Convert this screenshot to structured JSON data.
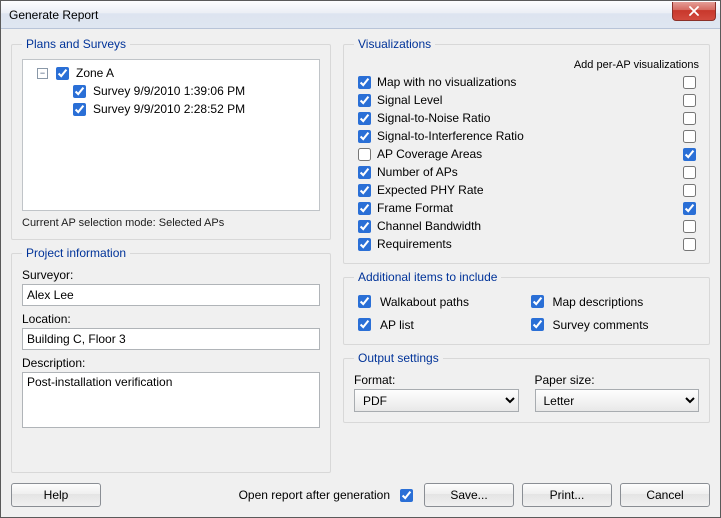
{
  "window": {
    "title": "Generate Report"
  },
  "plans": {
    "legend": "Plans and Surveys",
    "tree": {
      "root": {
        "label": "Zone A",
        "checked": true,
        "expanded": true
      },
      "children": [
        {
          "label": "Survey 9/9/2010 1:39:06 PM",
          "checked": true
        },
        {
          "label": "Survey 9/9/2010 2:28:52 PM",
          "checked": true
        }
      ]
    },
    "mode_note": "Current AP selection mode: Selected APs"
  },
  "project": {
    "legend": "Project information",
    "surveyor_label": "Surveyor:",
    "surveyor_value": "Alex Lee",
    "location_label": "Location:",
    "location_value": "Building C, Floor 3",
    "description_label": "Description:",
    "description_value": "Post-installation verification"
  },
  "vis": {
    "legend": "Visualizations",
    "per_ap_header": "Add per-AP visualizations",
    "items": [
      {
        "label": "Map with no visualizations",
        "c1": true,
        "c2": false
      },
      {
        "label": "Signal Level",
        "c1": true,
        "c2": false
      },
      {
        "label": "Signal-to-Noise Ratio",
        "c1": true,
        "c2": false
      },
      {
        "label": "Signal-to-Interference Ratio",
        "c1": true,
        "c2": false
      },
      {
        "label": "AP Coverage Areas",
        "c1": false,
        "c2": true
      },
      {
        "label": "Number of APs",
        "c1": true,
        "c2": false
      },
      {
        "label": "Expected PHY Rate",
        "c1": true,
        "c2": false
      },
      {
        "label": "Frame Format",
        "c1": true,
        "c2": true
      },
      {
        "label": "Channel Bandwidth",
        "c1": true,
        "c2": false
      },
      {
        "label": "Requirements",
        "c1": true,
        "c2": false
      }
    ]
  },
  "addl": {
    "legend": "Additional items to include",
    "items": [
      {
        "label": "Walkabout paths",
        "checked": true
      },
      {
        "label": "Map descriptions",
        "checked": true
      },
      {
        "label": "AP list",
        "checked": true
      },
      {
        "label": "Survey comments",
        "checked": true
      }
    ]
  },
  "output": {
    "legend": "Output settings",
    "format_label": "Format:",
    "format_value": "PDF",
    "paper_label": "Paper size:",
    "paper_value": "Letter"
  },
  "footer": {
    "help": "Help",
    "open_after_label": "Open report after generation",
    "open_after_checked": true,
    "save": "Save...",
    "print": "Print...",
    "cancel": "Cancel"
  }
}
